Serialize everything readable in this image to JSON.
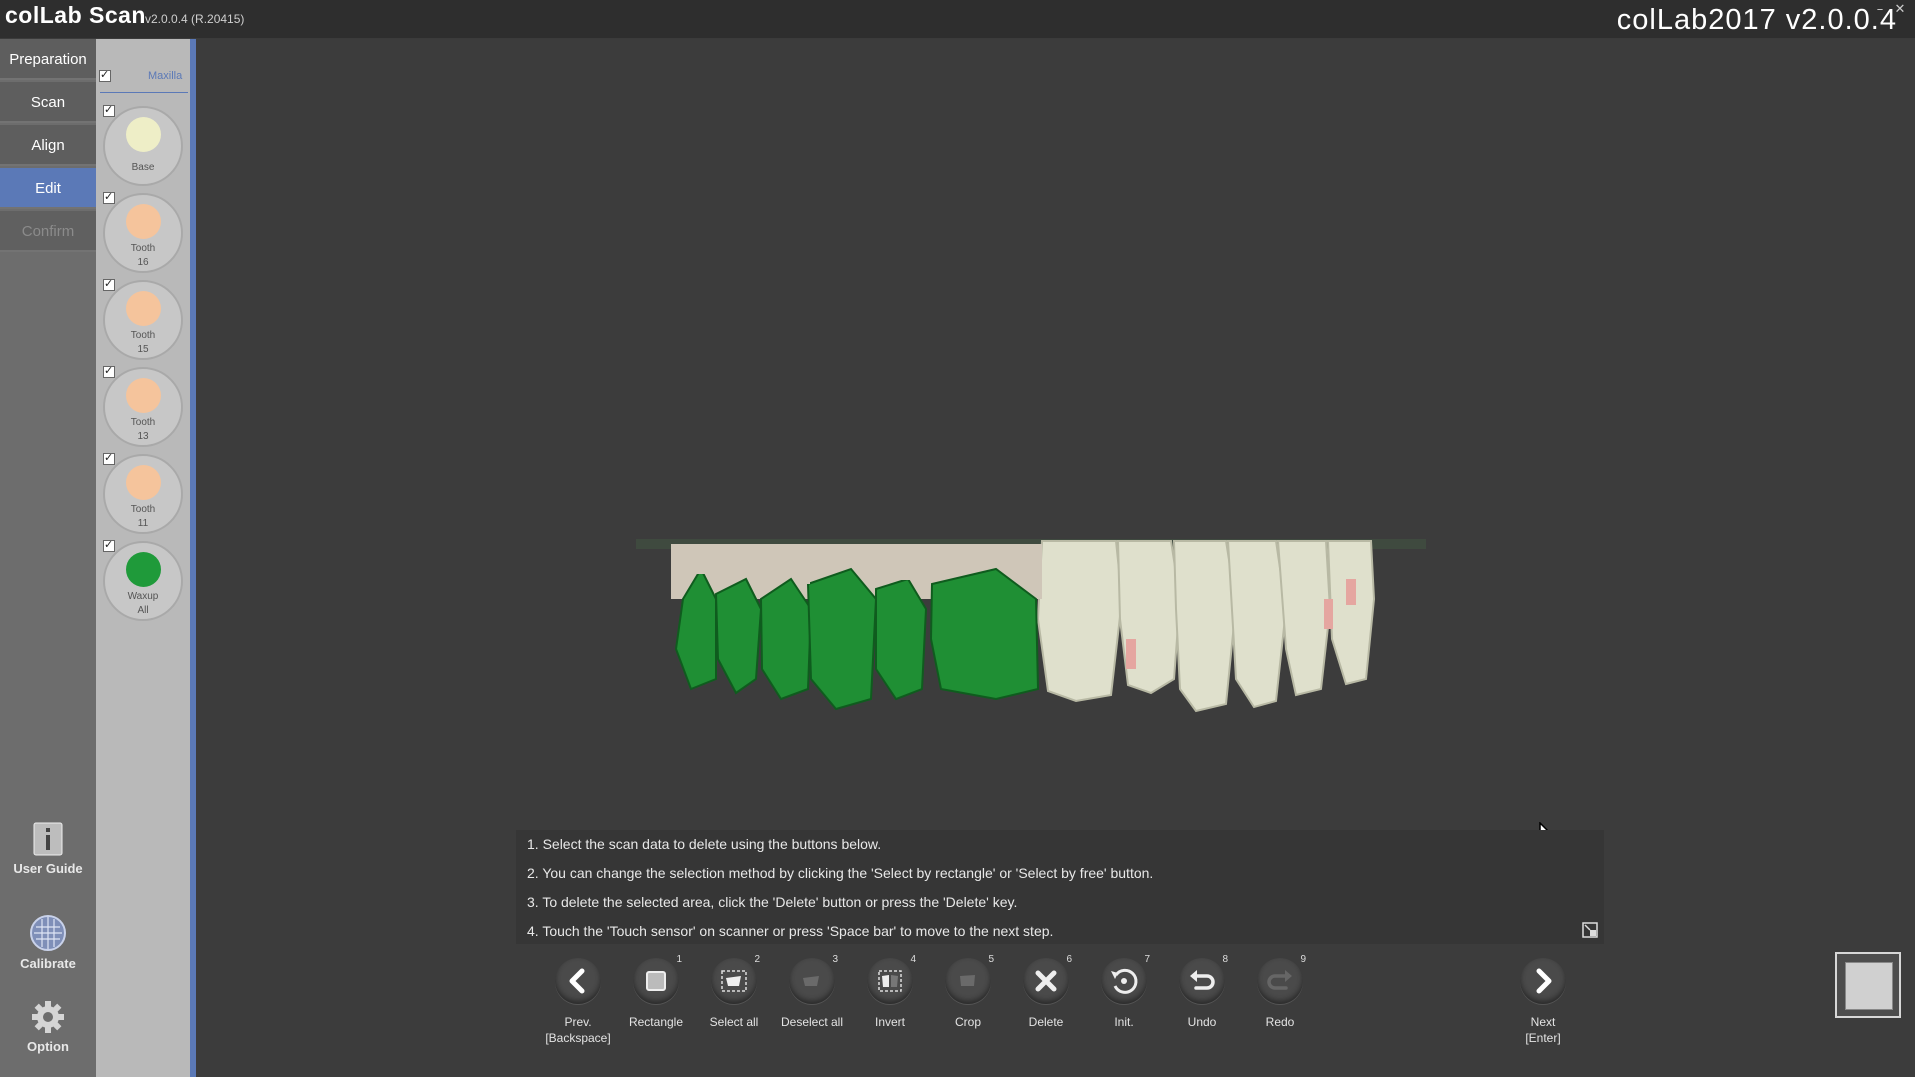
{
  "titlebar": {
    "app_name": "colLab Scan",
    "app_version": "v2.0.0.4 (R.20415)",
    "right_title": "colLab2017 v2.0.0.4"
  },
  "nav": {
    "items": [
      {
        "label": "Preparation",
        "state": "normal"
      },
      {
        "label": "Scan",
        "state": "normal"
      },
      {
        "label": "Align",
        "state": "normal"
      },
      {
        "label": "Edit",
        "state": "active"
      },
      {
        "label": "Confirm",
        "state": "disabled"
      }
    ],
    "tools": [
      {
        "label": "User Guide",
        "icon": "info-icon"
      },
      {
        "label": "Calibrate",
        "icon": "calibrate-grid-icon"
      },
      {
        "label": "Option",
        "icon": "gear-icon"
      }
    ]
  },
  "layers": {
    "group_label": "Maxilla",
    "group_checked": true,
    "items": [
      {
        "label_line1": "Base",
        "label_line2": "",
        "color": "#eeeec7",
        "checked": true
      },
      {
        "label_line1": "Tooth",
        "label_line2": "16",
        "color": "#f5c49c",
        "checked": true
      },
      {
        "label_line1": "Tooth",
        "label_line2": "15",
        "color": "#f5c49c",
        "checked": true
      },
      {
        "label_line1": "Tooth",
        "label_line2": "13",
        "color": "#f5c49c",
        "checked": true
      },
      {
        "label_line1": "Tooth",
        "label_line2": "11",
        "color": "#f5c49c",
        "checked": true
      },
      {
        "label_line1": "Waxup",
        "label_line2": "All",
        "color": "#1f9a3a",
        "checked": true
      }
    ]
  },
  "instructions": {
    "lines": [
      "1. Select the scan data to delete using the buttons below.",
      "2. You can change the selection method by clicking the 'Select by rectangle' or 'Select by free' button.",
      "3. To delete the selected area, click the 'Delete' button or press the 'Delete' key.",
      "4. Touch the 'Touch sensor' on scanner or press 'Space bar' to move to the next step."
    ]
  },
  "actions": {
    "prev": {
      "label_line1": "Prev.",
      "label_line2": "[Backspace]"
    },
    "next": {
      "label_line1": "Next",
      "label_line2": "[Enter]"
    },
    "buttons": [
      {
        "label": "Rectangle",
        "num": "1",
        "icon": "rectangle-select-icon"
      },
      {
        "label": "Select all",
        "num": "2",
        "icon": "select-all-icon"
      },
      {
        "label": "Deselect all",
        "num": "3",
        "icon": "deselect-all-icon"
      },
      {
        "label": "Invert",
        "num": "4",
        "icon": "invert-icon"
      },
      {
        "label": "Crop",
        "num": "5",
        "icon": "crop-icon"
      },
      {
        "label": "Delete",
        "num": "6",
        "icon": "delete-x-icon"
      },
      {
        "label": "Init.",
        "num": "7",
        "icon": "reset-icon"
      },
      {
        "label": "Undo",
        "num": "8",
        "icon": "undo-icon"
      },
      {
        "label": "Redo",
        "num": "9",
        "icon": "redo-icon"
      }
    ]
  },
  "colors": {
    "accent": "#5b79b7",
    "waxup_green": "#1f9a3a",
    "tooth_white": "#dfe0cc"
  }
}
